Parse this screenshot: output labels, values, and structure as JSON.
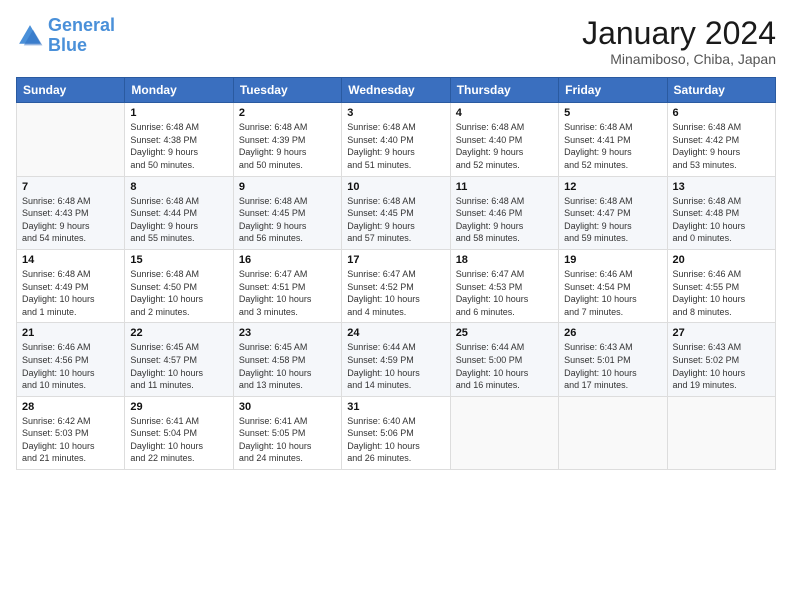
{
  "logo": {
    "line1": "General",
    "line2": "Blue"
  },
  "title": "January 2024",
  "location": "Minamiboso, Chiba, Japan",
  "weekdays": [
    "Sunday",
    "Monday",
    "Tuesday",
    "Wednesday",
    "Thursday",
    "Friday",
    "Saturday"
  ],
  "weeks": [
    [
      {
        "day": "",
        "info": ""
      },
      {
        "day": "1",
        "info": "Sunrise: 6:48 AM\nSunset: 4:38 PM\nDaylight: 9 hours\nand 50 minutes."
      },
      {
        "day": "2",
        "info": "Sunrise: 6:48 AM\nSunset: 4:39 PM\nDaylight: 9 hours\nand 50 minutes."
      },
      {
        "day": "3",
        "info": "Sunrise: 6:48 AM\nSunset: 4:40 PM\nDaylight: 9 hours\nand 51 minutes."
      },
      {
        "day": "4",
        "info": "Sunrise: 6:48 AM\nSunset: 4:40 PM\nDaylight: 9 hours\nand 52 minutes."
      },
      {
        "day": "5",
        "info": "Sunrise: 6:48 AM\nSunset: 4:41 PM\nDaylight: 9 hours\nand 52 minutes."
      },
      {
        "day": "6",
        "info": "Sunrise: 6:48 AM\nSunset: 4:42 PM\nDaylight: 9 hours\nand 53 minutes."
      }
    ],
    [
      {
        "day": "7",
        "info": "Sunrise: 6:48 AM\nSunset: 4:43 PM\nDaylight: 9 hours\nand 54 minutes."
      },
      {
        "day": "8",
        "info": "Sunrise: 6:48 AM\nSunset: 4:44 PM\nDaylight: 9 hours\nand 55 minutes."
      },
      {
        "day": "9",
        "info": "Sunrise: 6:48 AM\nSunset: 4:45 PM\nDaylight: 9 hours\nand 56 minutes."
      },
      {
        "day": "10",
        "info": "Sunrise: 6:48 AM\nSunset: 4:45 PM\nDaylight: 9 hours\nand 57 minutes."
      },
      {
        "day": "11",
        "info": "Sunrise: 6:48 AM\nSunset: 4:46 PM\nDaylight: 9 hours\nand 58 minutes."
      },
      {
        "day": "12",
        "info": "Sunrise: 6:48 AM\nSunset: 4:47 PM\nDaylight: 9 hours\nand 59 minutes."
      },
      {
        "day": "13",
        "info": "Sunrise: 6:48 AM\nSunset: 4:48 PM\nDaylight: 10 hours\nand 0 minutes."
      }
    ],
    [
      {
        "day": "14",
        "info": "Sunrise: 6:48 AM\nSunset: 4:49 PM\nDaylight: 10 hours\nand 1 minute."
      },
      {
        "day": "15",
        "info": "Sunrise: 6:48 AM\nSunset: 4:50 PM\nDaylight: 10 hours\nand 2 minutes."
      },
      {
        "day": "16",
        "info": "Sunrise: 6:47 AM\nSunset: 4:51 PM\nDaylight: 10 hours\nand 3 minutes."
      },
      {
        "day": "17",
        "info": "Sunrise: 6:47 AM\nSunset: 4:52 PM\nDaylight: 10 hours\nand 4 minutes."
      },
      {
        "day": "18",
        "info": "Sunrise: 6:47 AM\nSunset: 4:53 PM\nDaylight: 10 hours\nand 6 minutes."
      },
      {
        "day": "19",
        "info": "Sunrise: 6:46 AM\nSunset: 4:54 PM\nDaylight: 10 hours\nand 7 minutes."
      },
      {
        "day": "20",
        "info": "Sunrise: 6:46 AM\nSunset: 4:55 PM\nDaylight: 10 hours\nand 8 minutes."
      }
    ],
    [
      {
        "day": "21",
        "info": "Sunrise: 6:46 AM\nSunset: 4:56 PM\nDaylight: 10 hours\nand 10 minutes."
      },
      {
        "day": "22",
        "info": "Sunrise: 6:45 AM\nSunset: 4:57 PM\nDaylight: 10 hours\nand 11 minutes."
      },
      {
        "day": "23",
        "info": "Sunrise: 6:45 AM\nSunset: 4:58 PM\nDaylight: 10 hours\nand 13 minutes."
      },
      {
        "day": "24",
        "info": "Sunrise: 6:44 AM\nSunset: 4:59 PM\nDaylight: 10 hours\nand 14 minutes."
      },
      {
        "day": "25",
        "info": "Sunrise: 6:44 AM\nSunset: 5:00 PM\nDaylight: 10 hours\nand 16 minutes."
      },
      {
        "day": "26",
        "info": "Sunrise: 6:43 AM\nSunset: 5:01 PM\nDaylight: 10 hours\nand 17 minutes."
      },
      {
        "day": "27",
        "info": "Sunrise: 6:43 AM\nSunset: 5:02 PM\nDaylight: 10 hours\nand 19 minutes."
      }
    ],
    [
      {
        "day": "28",
        "info": "Sunrise: 6:42 AM\nSunset: 5:03 PM\nDaylight: 10 hours\nand 21 minutes."
      },
      {
        "day": "29",
        "info": "Sunrise: 6:41 AM\nSunset: 5:04 PM\nDaylight: 10 hours\nand 22 minutes."
      },
      {
        "day": "30",
        "info": "Sunrise: 6:41 AM\nSunset: 5:05 PM\nDaylight: 10 hours\nand 24 minutes."
      },
      {
        "day": "31",
        "info": "Sunrise: 6:40 AM\nSunset: 5:06 PM\nDaylight: 10 hours\nand 26 minutes."
      },
      {
        "day": "",
        "info": ""
      },
      {
        "day": "",
        "info": ""
      },
      {
        "day": "",
        "info": ""
      }
    ]
  ]
}
